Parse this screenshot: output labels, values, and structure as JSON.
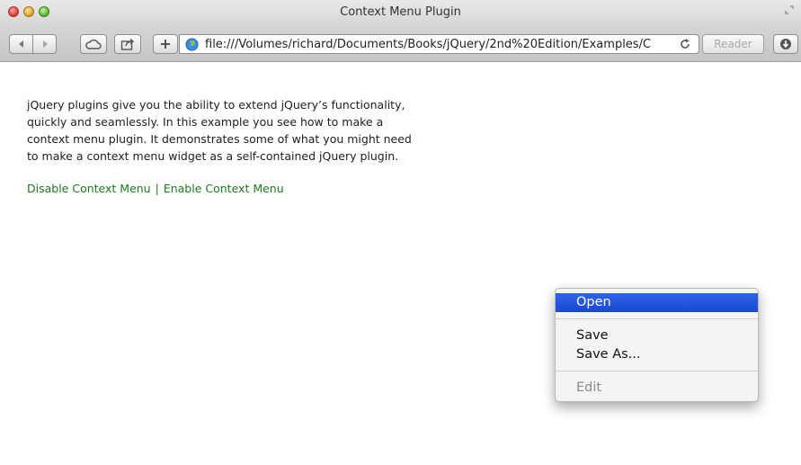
{
  "window": {
    "title": "Context Menu Plugin"
  },
  "toolbar": {
    "url": "file:///Volumes/richard/Documents/Books/jQuery/2nd%20Edition/Examples/C",
    "reader_label": "Reader",
    "icons": [
      "back-arrow",
      "forward-arrow",
      "icloud",
      "share",
      "plus",
      "globe",
      "reload",
      "download"
    ]
  },
  "page": {
    "intro_lines": [
      "jQuery plugins give you the ability to extend jQuery’s functionality,",
      "quickly and seamlessly. In this example you see how to make a",
      "context menu plugin. It demonstrates some of what you might need",
      "to make a context menu widget as a self-contained jQuery plugin."
    ],
    "links": {
      "disable": "Disable Context Menu",
      "separator": "|",
      "enable": "Enable Context Menu"
    },
    "link_color": "#1a7a1a"
  },
  "context_menu": {
    "items": [
      {
        "label": "Open",
        "state": "highlighted"
      },
      {
        "label": "Save",
        "state": "normal"
      },
      {
        "label": "Save As...",
        "state": "normal"
      },
      {
        "label": "Edit",
        "state": "disabled"
      }
    ],
    "highlight_color": "#1a48d4"
  }
}
